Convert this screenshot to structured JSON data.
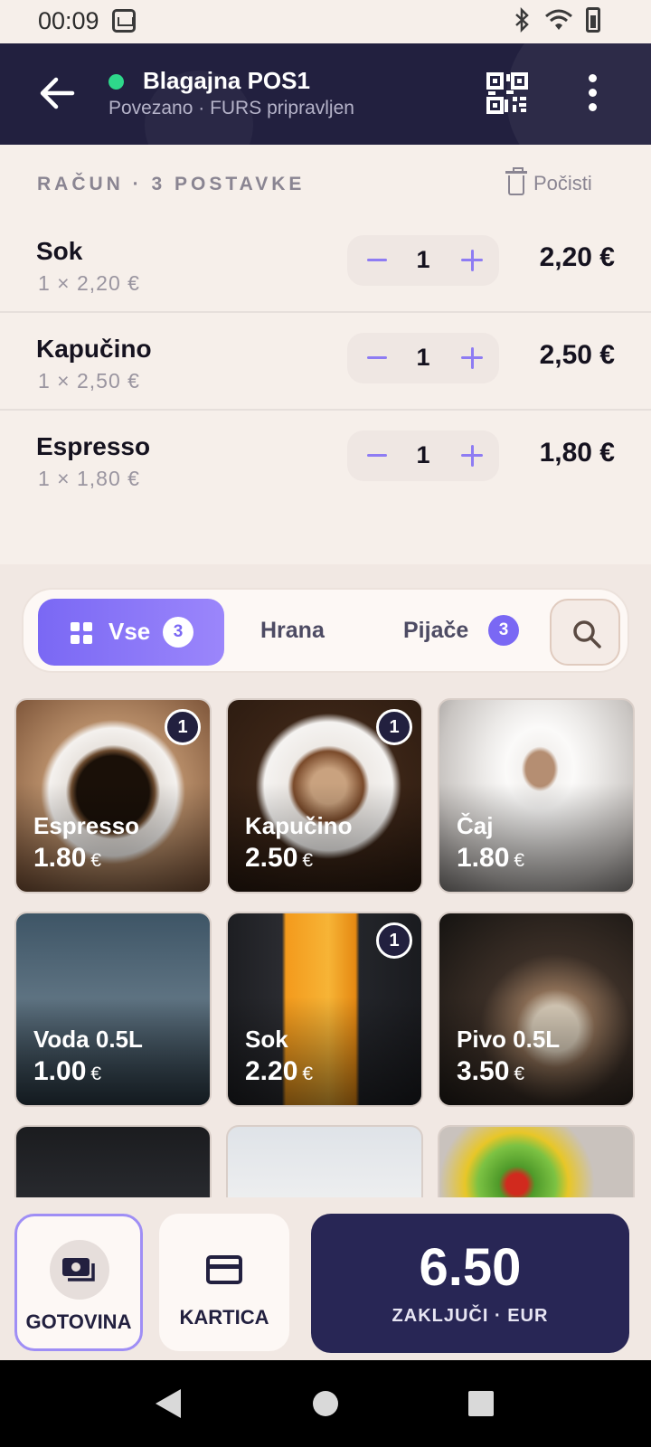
{
  "status_bar": {
    "time": "00:09"
  },
  "header": {
    "title": "Blagajna POS1",
    "subtitle": "Povezano · FURS pripravljen",
    "status_color": "#2ed88b"
  },
  "receipt": {
    "heading": "RAČUN · 3 POSTAVKE",
    "clear_label": "Počisti",
    "items": [
      {
        "name": "Sok",
        "detail": "1 × 2,20 €",
        "qty": "1",
        "total": "2,20 €"
      },
      {
        "name": "Kapučino",
        "detail": "1 × 2,50 €",
        "qty": "1",
        "total": "2,50 €"
      },
      {
        "name": "Espresso",
        "detail": "1 × 1,80 €",
        "qty": "1",
        "total": "1,80 €"
      }
    ]
  },
  "tabs": {
    "all_label": "Vse",
    "all_count": "3",
    "food_label": "Hrana",
    "drinks_label": "Pijače",
    "drinks_count": "3"
  },
  "products": [
    {
      "name": "Espresso",
      "price": "1.80",
      "currency": "€",
      "badge": "1"
    },
    {
      "name": "Kapučino",
      "price": "2.50",
      "currency": "€",
      "badge": "1"
    },
    {
      "name": "Čaj",
      "price": "1.80",
      "currency": "€",
      "badge": ""
    },
    {
      "name": "Voda 0.5L",
      "price": "1.00",
      "currency": "€",
      "badge": ""
    },
    {
      "name": "Sok",
      "price": "2.20",
      "currency": "€",
      "badge": "1"
    },
    {
      "name": "Pivo 0.5L",
      "price": "3.50",
      "currency": "€",
      "badge": ""
    }
  ],
  "payment": {
    "cash_label": "GOTOVINA",
    "card_label": "KARTICA",
    "total": "6.50",
    "checkout_label": "ZAKLJUČI · EUR"
  },
  "colors": {
    "header_bg": "#22203f",
    "accent": "#7a68f4",
    "checkout_bg": "#282655"
  }
}
